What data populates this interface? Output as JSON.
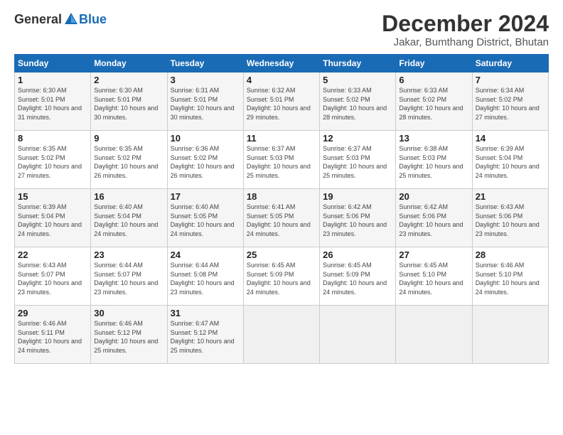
{
  "logo": {
    "general": "General",
    "blue": "Blue"
  },
  "title": "December 2024",
  "location": "Jakar, Bumthang District, Bhutan",
  "days_of_week": [
    "Sunday",
    "Monday",
    "Tuesday",
    "Wednesday",
    "Thursday",
    "Friday",
    "Saturday"
  ],
  "weeks": [
    [
      {
        "day": "1",
        "sunrise": "Sunrise: 6:30 AM",
        "sunset": "Sunset: 5:01 PM",
        "daylight": "Daylight: 10 hours and 31 minutes."
      },
      {
        "day": "2",
        "sunrise": "Sunrise: 6:30 AM",
        "sunset": "Sunset: 5:01 PM",
        "daylight": "Daylight: 10 hours and 30 minutes."
      },
      {
        "day": "3",
        "sunrise": "Sunrise: 6:31 AM",
        "sunset": "Sunset: 5:01 PM",
        "daylight": "Daylight: 10 hours and 30 minutes."
      },
      {
        "day": "4",
        "sunrise": "Sunrise: 6:32 AM",
        "sunset": "Sunset: 5:01 PM",
        "daylight": "Daylight: 10 hours and 29 minutes."
      },
      {
        "day": "5",
        "sunrise": "Sunrise: 6:33 AM",
        "sunset": "Sunset: 5:02 PM",
        "daylight": "Daylight: 10 hours and 28 minutes."
      },
      {
        "day": "6",
        "sunrise": "Sunrise: 6:33 AM",
        "sunset": "Sunset: 5:02 PM",
        "daylight": "Daylight: 10 hours and 28 minutes."
      },
      {
        "day": "7",
        "sunrise": "Sunrise: 6:34 AM",
        "sunset": "Sunset: 5:02 PM",
        "daylight": "Daylight: 10 hours and 27 minutes."
      }
    ],
    [
      {
        "day": "8",
        "sunrise": "Sunrise: 6:35 AM",
        "sunset": "Sunset: 5:02 PM",
        "daylight": "Daylight: 10 hours and 27 minutes."
      },
      {
        "day": "9",
        "sunrise": "Sunrise: 6:35 AM",
        "sunset": "Sunset: 5:02 PM",
        "daylight": "Daylight: 10 hours and 26 minutes."
      },
      {
        "day": "10",
        "sunrise": "Sunrise: 6:36 AM",
        "sunset": "Sunset: 5:02 PM",
        "daylight": "Daylight: 10 hours and 26 minutes."
      },
      {
        "day": "11",
        "sunrise": "Sunrise: 6:37 AM",
        "sunset": "Sunset: 5:03 PM",
        "daylight": "Daylight: 10 hours and 25 minutes."
      },
      {
        "day": "12",
        "sunrise": "Sunrise: 6:37 AM",
        "sunset": "Sunset: 5:03 PM",
        "daylight": "Daylight: 10 hours and 25 minutes."
      },
      {
        "day": "13",
        "sunrise": "Sunrise: 6:38 AM",
        "sunset": "Sunset: 5:03 PM",
        "daylight": "Daylight: 10 hours and 25 minutes."
      },
      {
        "day": "14",
        "sunrise": "Sunrise: 6:39 AM",
        "sunset": "Sunset: 5:04 PM",
        "daylight": "Daylight: 10 hours and 24 minutes."
      }
    ],
    [
      {
        "day": "15",
        "sunrise": "Sunrise: 6:39 AM",
        "sunset": "Sunset: 5:04 PM",
        "daylight": "Daylight: 10 hours and 24 minutes."
      },
      {
        "day": "16",
        "sunrise": "Sunrise: 6:40 AM",
        "sunset": "Sunset: 5:04 PM",
        "daylight": "Daylight: 10 hours and 24 minutes."
      },
      {
        "day": "17",
        "sunrise": "Sunrise: 6:40 AM",
        "sunset": "Sunset: 5:05 PM",
        "daylight": "Daylight: 10 hours and 24 minutes."
      },
      {
        "day": "18",
        "sunrise": "Sunrise: 6:41 AM",
        "sunset": "Sunset: 5:05 PM",
        "daylight": "Daylight: 10 hours and 24 minutes."
      },
      {
        "day": "19",
        "sunrise": "Sunrise: 6:42 AM",
        "sunset": "Sunset: 5:06 PM",
        "daylight": "Daylight: 10 hours and 23 minutes."
      },
      {
        "day": "20",
        "sunrise": "Sunrise: 6:42 AM",
        "sunset": "Sunset: 5:06 PM",
        "daylight": "Daylight: 10 hours and 23 minutes."
      },
      {
        "day": "21",
        "sunrise": "Sunrise: 6:43 AM",
        "sunset": "Sunset: 5:06 PM",
        "daylight": "Daylight: 10 hours and 23 minutes."
      }
    ],
    [
      {
        "day": "22",
        "sunrise": "Sunrise: 6:43 AM",
        "sunset": "Sunset: 5:07 PM",
        "daylight": "Daylight: 10 hours and 23 minutes."
      },
      {
        "day": "23",
        "sunrise": "Sunrise: 6:44 AM",
        "sunset": "Sunset: 5:07 PM",
        "daylight": "Daylight: 10 hours and 23 minutes."
      },
      {
        "day": "24",
        "sunrise": "Sunrise: 6:44 AM",
        "sunset": "Sunset: 5:08 PM",
        "daylight": "Daylight: 10 hours and 23 minutes."
      },
      {
        "day": "25",
        "sunrise": "Sunrise: 6:45 AM",
        "sunset": "Sunset: 5:09 PM",
        "daylight": "Daylight: 10 hours and 24 minutes."
      },
      {
        "day": "26",
        "sunrise": "Sunrise: 6:45 AM",
        "sunset": "Sunset: 5:09 PM",
        "daylight": "Daylight: 10 hours and 24 minutes."
      },
      {
        "day": "27",
        "sunrise": "Sunrise: 6:45 AM",
        "sunset": "Sunset: 5:10 PM",
        "daylight": "Daylight: 10 hours and 24 minutes."
      },
      {
        "day": "28",
        "sunrise": "Sunrise: 6:46 AM",
        "sunset": "Sunset: 5:10 PM",
        "daylight": "Daylight: 10 hours and 24 minutes."
      }
    ],
    [
      {
        "day": "29",
        "sunrise": "Sunrise: 6:46 AM",
        "sunset": "Sunset: 5:11 PM",
        "daylight": "Daylight: 10 hours and 24 minutes."
      },
      {
        "day": "30",
        "sunrise": "Sunrise: 6:46 AM",
        "sunset": "Sunset: 5:12 PM",
        "daylight": "Daylight: 10 hours and 25 minutes."
      },
      {
        "day": "31",
        "sunrise": "Sunrise: 6:47 AM",
        "sunset": "Sunset: 5:12 PM",
        "daylight": "Daylight: 10 hours and 25 minutes."
      },
      null,
      null,
      null,
      null
    ]
  ]
}
